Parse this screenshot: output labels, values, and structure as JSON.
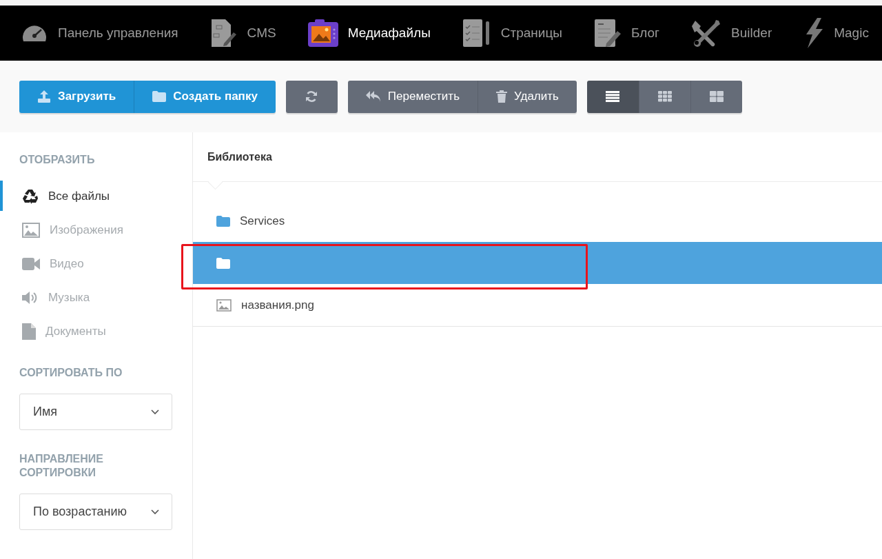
{
  "nav": [
    {
      "label": "Панель управления",
      "kind": "gauge",
      "selected": false
    },
    {
      "label": "CMS",
      "kind": "cms",
      "selected": false
    },
    {
      "label": "Медиафайлы",
      "kind": "media",
      "selected": true
    },
    {
      "label": "Страницы",
      "kind": "pages",
      "selected": false
    },
    {
      "label": "Блог",
      "kind": "blog",
      "selected": false
    },
    {
      "label": "Builder",
      "kind": "tools",
      "selected": false
    },
    {
      "label": "Magic",
      "kind": "bolt",
      "selected": false
    }
  ],
  "toolbar": [
    {
      "kind": "primary",
      "buttons": [
        {
          "label": "Загрузить",
          "kind": "upload"
        },
        {
          "label": "Создать папку",
          "kind": "folder"
        }
      ]
    },
    {
      "kind": "gray",
      "buttons": [
        {
          "kind": "refresh"
        }
      ]
    },
    {
      "kind": "gray",
      "buttons": [
        {
          "label": "Переместить",
          "kind": "move"
        },
        {
          "label": "Удалить",
          "kind": "trash"
        }
      ]
    },
    {
      "kind": "gray",
      "buttons": [
        {
          "kind": "list",
          "selected": true
        },
        {
          "kind": "grid",
          "selected": false
        },
        {
          "kind": "tiles",
          "selected": false
        }
      ]
    }
  ],
  "sidebar": {
    "display_heading": "ОТОБРАЗИТЬ",
    "filters": [
      {
        "label": "Все файлы",
        "kind": "recycle",
        "selected": true
      },
      {
        "label": "Изображения",
        "kind": "image",
        "selected": false
      },
      {
        "label": "Видео",
        "kind": "video",
        "selected": false
      },
      {
        "label": "Музыка",
        "kind": "sound",
        "selected": false
      },
      {
        "label": "Документы",
        "kind": "doc",
        "selected": false
      }
    ],
    "sort_heading": "СОРТИРОВАТЬ ПО",
    "sort_value": "Имя",
    "direction_heading": "НАПРАВЛЕНИЕ СОРТИРОВКИ",
    "direction_value": "По возрастанию"
  },
  "breadcrumb": "Библиотека",
  "files": [
    {
      "name": "Services",
      "kind": "folder",
      "selected": false
    },
    {
      "kind": "folder",
      "selected": true
    },
    {
      "name": "названия.png",
      "kind": "image",
      "selected": false
    }
  ],
  "annotation": {
    "on": true
  }
}
